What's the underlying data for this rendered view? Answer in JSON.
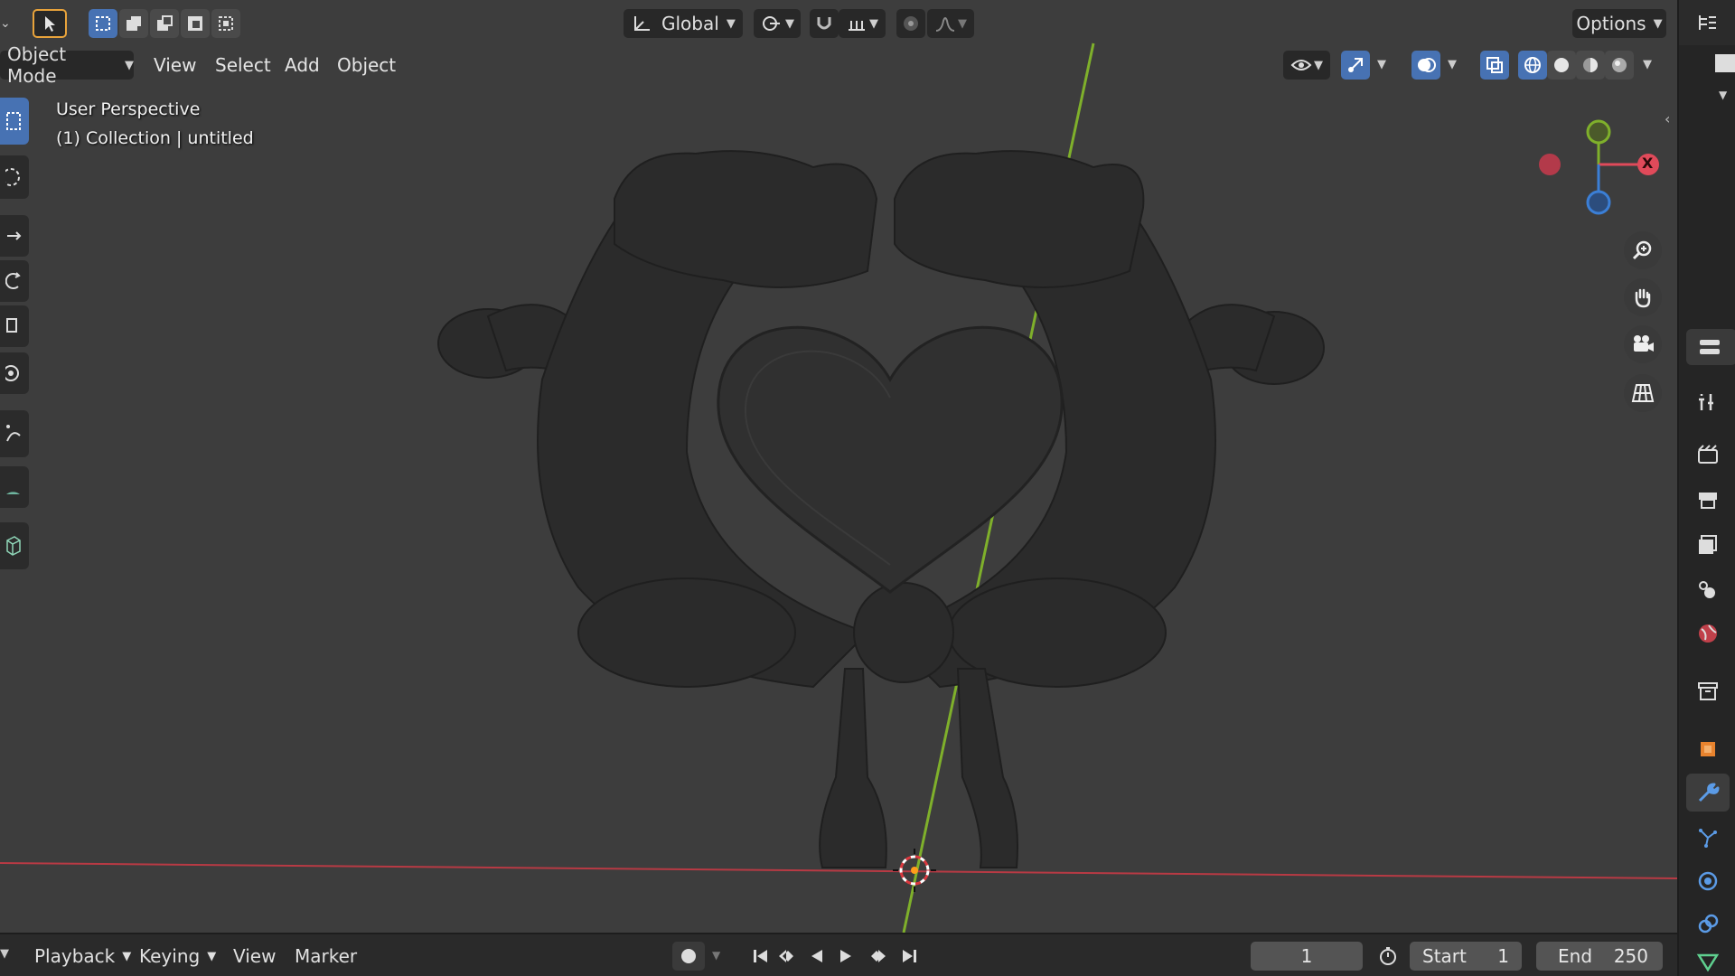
{
  "header": {
    "transform_orientation": "Global",
    "options_label": "Options"
  },
  "menubar": {
    "mode": "Object Mode",
    "items": [
      "View",
      "Select",
      "Add",
      "Object"
    ]
  },
  "viewport": {
    "perspective_label": "User Perspective",
    "collection_label": "(1) Collection | untitled"
  },
  "gizmo": {
    "x_label": "X"
  },
  "timeline": {
    "playback": "Playback",
    "keying": "Keying",
    "view": "View",
    "marker": "Marker",
    "current_frame": "1",
    "start_label": "Start",
    "start_value": "1",
    "end_label": "End",
    "end_value": "250"
  },
  "colors": {
    "accent": "#4772b3",
    "x_axis": "#e04a5a",
    "y_axis": "#7fb02b",
    "z_axis": "#3b7fd6",
    "background": "#3d3d3d"
  },
  "icons": {
    "toolbar": [
      "select-box-icon",
      "cursor-icon",
      "move-icon",
      "rotate-icon",
      "scale-icon",
      "transform-icon",
      "annotate-icon",
      "measure-icon",
      "add-cube-icon"
    ],
    "nav": [
      "zoom-icon",
      "hand-pan-icon",
      "camera-icon",
      "grid-icon"
    ],
    "properties": [
      "tool-icon",
      "render-icon",
      "output-icon",
      "view-layer-icon",
      "scene-icon",
      "world-icon",
      "collection-icon",
      "object-icon",
      "modifier-icon",
      "particles-icon",
      "physics-icon",
      "constraints-icon",
      "data-icon"
    ]
  }
}
